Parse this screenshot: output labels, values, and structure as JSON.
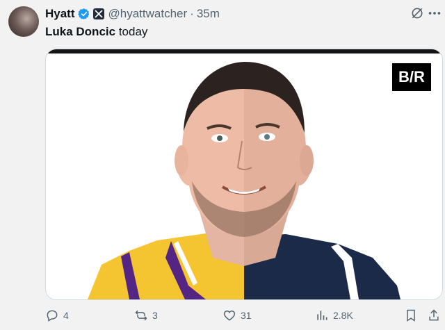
{
  "author": {
    "name": "Hyatt",
    "handle": "@hyattwatcher",
    "separator": "·",
    "time": "35m",
    "verified_icon": "verified-badge-icon",
    "affiliate_icon": "x-affiliate-icon"
  },
  "tweet": {
    "bold_text": "Luka Doncic",
    "text": " today"
  },
  "media": {
    "brand_badge": "B/R",
    "description_icon": "split-portrait-image"
  },
  "actions": {
    "replies": "4",
    "reposts": "3",
    "likes": "31",
    "views": "2.8K"
  },
  "colors": {
    "accent": "#1d9bf0",
    "muted": "#536471",
    "lakers_gold": "#f5c431",
    "lakers_purple": "#552583",
    "mavs_navy": "#1c2a4a"
  }
}
